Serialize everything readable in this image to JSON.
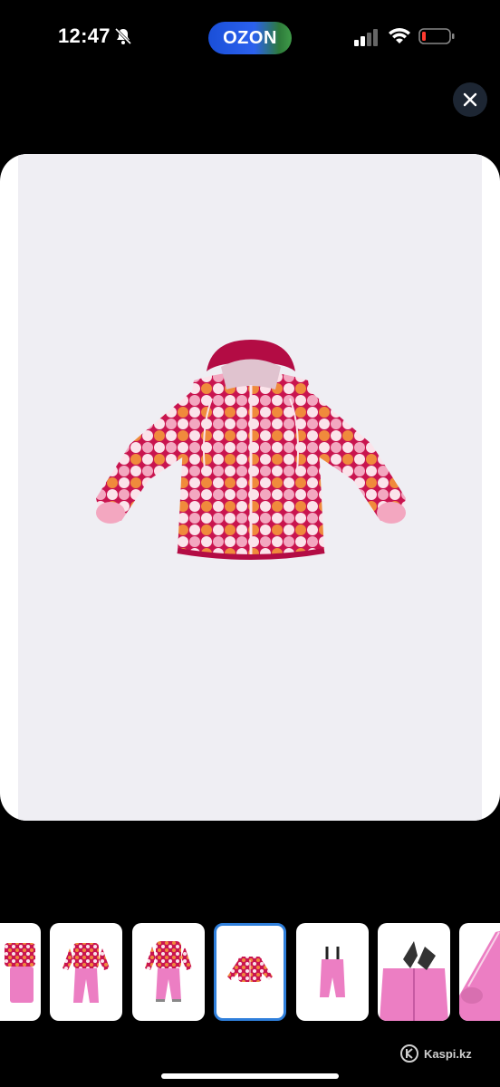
{
  "status_bar": {
    "time": "12:47",
    "island_logo": "OZON"
  },
  "viewer": {
    "close_icon": "close-icon",
    "main_image": "pink patterned child winter jacket"
  },
  "thumbnails": [
    {
      "name": "thumb-jacket-pants-set-partial",
      "selected": false
    },
    {
      "name": "thumb-jacket-pants-set-1",
      "selected": false
    },
    {
      "name": "thumb-jacket-pants-set-2",
      "selected": false
    },
    {
      "name": "thumb-jacket",
      "selected": true
    },
    {
      "name": "thumb-pants",
      "selected": false
    },
    {
      "name": "thumb-pants-closeup",
      "selected": false
    },
    {
      "name": "thumb-sleeve-closeup",
      "selected": false
    }
  ],
  "watermark": {
    "text": "Kaspi.kz"
  },
  "colors": {
    "background": "#000000",
    "image_bg": "#efeef3",
    "selected_border": "#2f7fdb",
    "jacket_main": "#c9144f",
    "jacket_accent": "#f08a3c"
  }
}
